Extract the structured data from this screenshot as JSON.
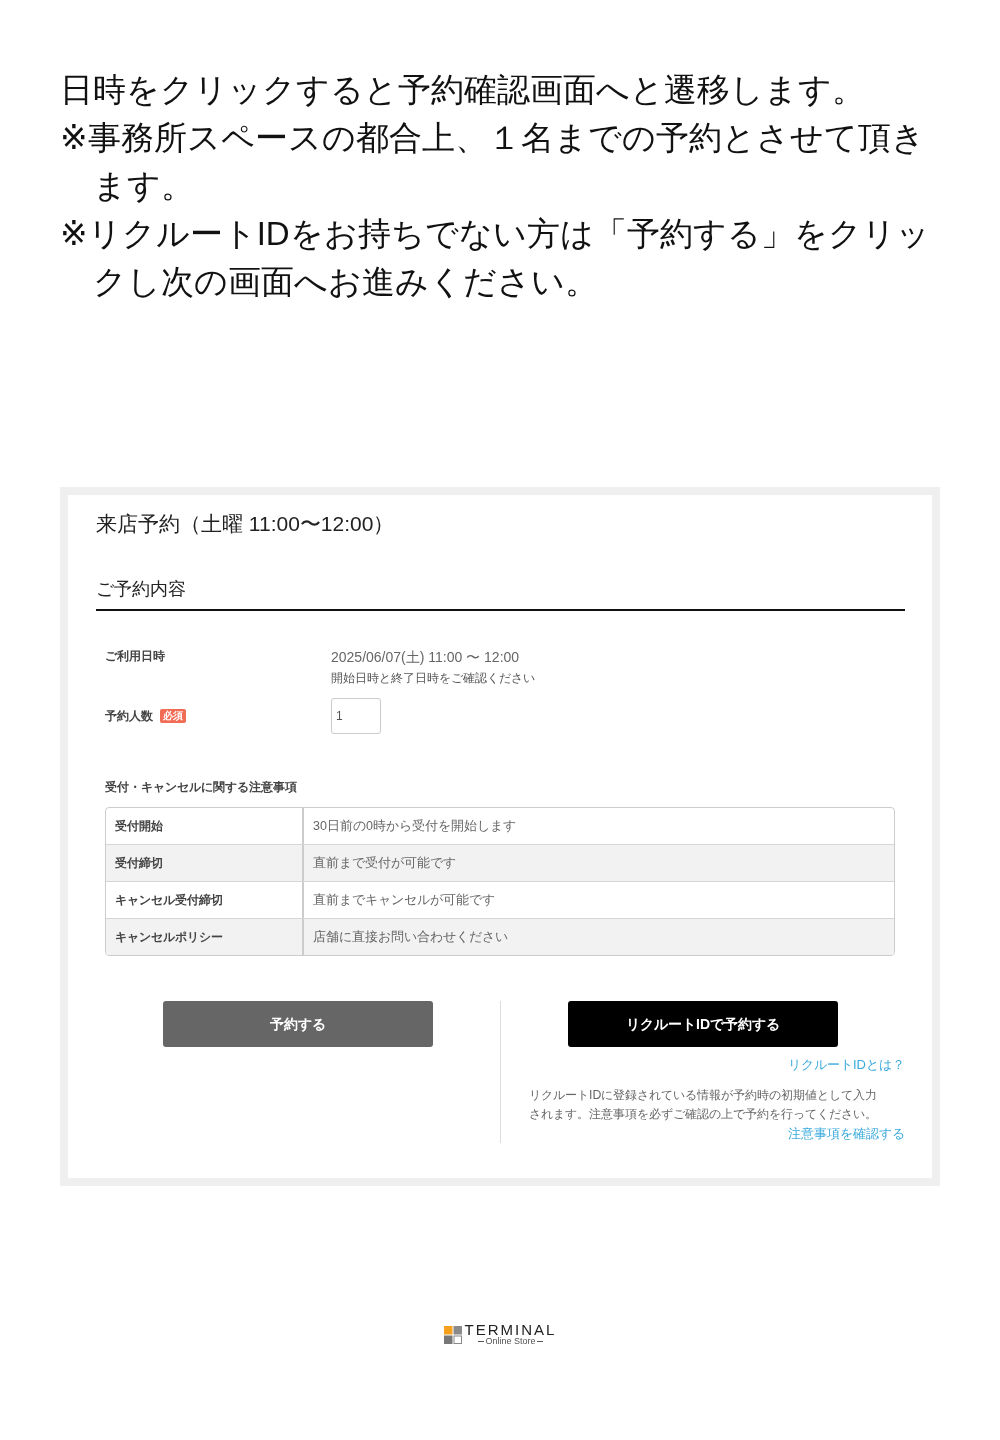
{
  "intro": {
    "lead": "日時をクリックすると予約確認画面へと遷移します。",
    "notes": [
      "※事務所スペースの都合上、１名までの予約とさせて頂きます。",
      "※リクルートIDをお持ちでない方は「予約する」をクリックし次の画面へお進みください。"
    ]
  },
  "booking": {
    "title": "来店予約（土曜 11:00〜12:00）",
    "section_heading": "ご予約内容",
    "fields": [
      {
        "kind": "text",
        "label": "ご利用日時",
        "value": "2025/06/07(土) 11:00 〜 12:00",
        "note": "開始日時と終了日時をご確認ください"
      },
      {
        "kind": "input",
        "label": "予約人数",
        "badge": "必須",
        "value": "1"
      }
    ],
    "notes_heading": "受付・キャンセルに関する注意事項",
    "notes_table": {
      "rows": [
        [
          "受付開始",
          "30日前の0時から受付を開始します"
        ],
        [
          "受付締切",
          "直前まで受付が可能です"
        ],
        [
          "キャンセル受付締切",
          "直前までキャンセルが可能です"
        ],
        [
          "キャンセルポリシー",
          "店舗に直接お問い合わせください"
        ]
      ]
    },
    "reserve_button": "予約する",
    "recruit": {
      "button": "リクルートIDで予約する",
      "about_link": "リクルートIDとは？",
      "description": "リクルートIDに登録されている情報が予約時の初期値として入力されます。注意事項を必ずご確認の上で予約を行ってください。",
      "notes_link": "注意事項を確認する"
    }
  },
  "footer": {
    "logo_name": "TERMINAL",
    "logo_tagline": "Online Store"
  }
}
